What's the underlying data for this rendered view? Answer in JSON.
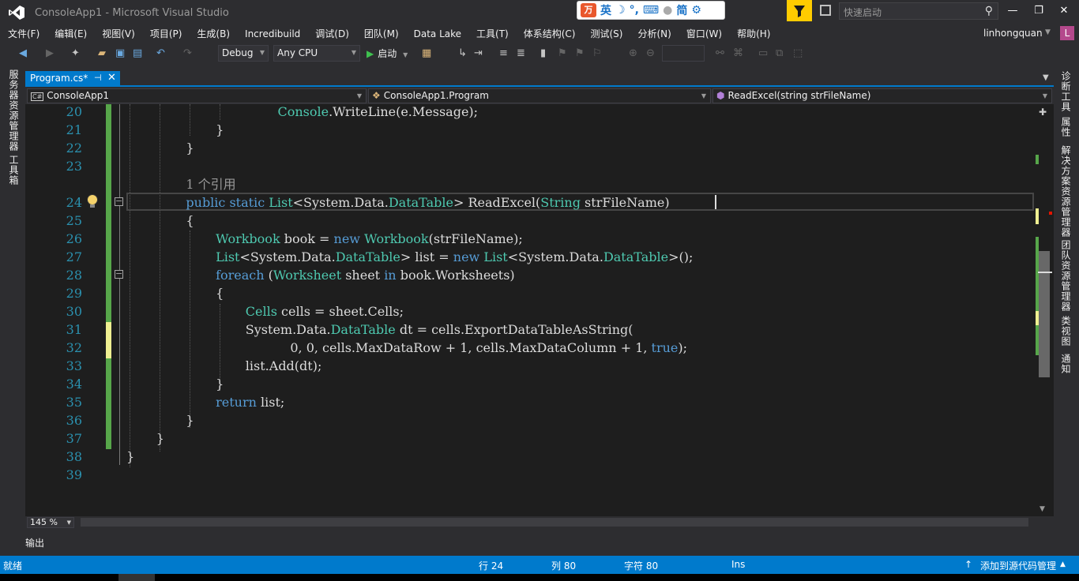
{
  "window": {
    "title": "ConsoleApp1 - Microsoft Visual Studio",
    "quick_launch_placeholder": "快速启动",
    "user": "linhongquan",
    "avatar_letter": "L"
  },
  "ime": {
    "logo": "万",
    "mode": "英",
    "script": "简"
  },
  "menu": [
    "文件(F)",
    "编辑(E)",
    "视图(V)",
    "项目(P)",
    "生成(B)",
    "Incredibuild",
    "调试(D)",
    "团队(M)",
    "Data Lake",
    "工具(T)",
    "体系结构(C)",
    "测试(S)",
    "分析(N)",
    "窗口(W)",
    "帮助(H)"
  ],
  "toolbar": {
    "configuration": "Debug",
    "platform": "Any CPU",
    "start_label": "启动"
  },
  "left_tabs": [
    "服务器资源管理器",
    "工具箱"
  ],
  "right_tabs": [
    "诊断工具",
    "属性",
    "解决方案资源管理器",
    "团队资源管理器",
    "类视图",
    "通知"
  ],
  "document_tab": "Program.cs*",
  "navbar": {
    "project": "ConsoleApp1",
    "class": "ConsoleApp1.Program",
    "member": "ReadExcel(string strFileName)"
  },
  "editor": {
    "zoom": "145 %",
    "codelens": "1 个引用",
    "lines": [
      {
        "n": "20",
        "tokens": [
          [
            "pl",
            "        "
          ],
          [
            "ty",
            "Console"
          ],
          [
            "pl",
            ".WriteLine(e.Message);"
          ]
        ],
        "indent": 4
      },
      {
        "n": "21",
        "tokens": [
          [
            "pl",
            "}"
          ]
        ],
        "indent": 3
      },
      {
        "n": "22",
        "tokens": [
          [
            "pl",
            "}"
          ]
        ],
        "indent": 2
      },
      {
        "n": "23",
        "tokens": [],
        "indent": 0
      },
      {
        "n": "",
        "tokens": [
          [
            "cl",
            "1 个引用"
          ]
        ],
        "indent": 2,
        "codelens": true
      },
      {
        "n": "24",
        "tokens": [
          [
            "kw",
            "public"
          ],
          [
            "pl",
            " "
          ],
          [
            "kw",
            "static"
          ],
          [
            "pl",
            " "
          ],
          [
            "ty",
            "List"
          ],
          [
            "pl",
            "<System.Data."
          ],
          [
            "ty",
            "DataTable"
          ],
          [
            "pl",
            "> ReadExcel("
          ],
          [
            "ty",
            "String"
          ],
          [
            "pl",
            " strFileName)"
          ]
        ],
        "indent": 2
      },
      {
        "n": "25",
        "tokens": [
          [
            "pl",
            "{"
          ]
        ],
        "indent": 2
      },
      {
        "n": "26",
        "tokens": [
          [
            "ty",
            "Workbook"
          ],
          [
            "pl",
            " book = "
          ],
          [
            "kw",
            "new"
          ],
          [
            "pl",
            " "
          ],
          [
            "ty",
            "Workbook"
          ],
          [
            "pl",
            "(strFileName);"
          ]
        ],
        "indent": 3
      },
      {
        "n": "27",
        "tokens": [
          [
            "ty",
            "List"
          ],
          [
            "pl",
            "<System.Data."
          ],
          [
            "ty",
            "DataTable"
          ],
          [
            "pl",
            "> list = "
          ],
          [
            "kw",
            "new"
          ],
          [
            "pl",
            " "
          ],
          [
            "ty",
            "List"
          ],
          [
            "pl",
            "<System.Data."
          ],
          [
            "ty",
            "DataTable"
          ],
          [
            "pl",
            ">();"
          ]
        ],
        "indent": 3
      },
      {
        "n": "28",
        "tokens": [
          [
            "kw",
            "foreach"
          ],
          [
            "pl",
            " ("
          ],
          [
            "ty",
            "Worksheet"
          ],
          [
            "pl",
            " sheet "
          ],
          [
            "kw",
            "in"
          ],
          [
            "pl",
            " book.Worksheets)"
          ]
        ],
        "indent": 3
      },
      {
        "n": "29",
        "tokens": [
          [
            "pl",
            "{"
          ]
        ],
        "indent": 3
      },
      {
        "n": "30",
        "tokens": [
          [
            "ty",
            "Cells"
          ],
          [
            "pl",
            " cells = sheet.Cells;"
          ]
        ],
        "indent": 4
      },
      {
        "n": "31",
        "tokens": [
          [
            "pl",
            "System.Data."
          ],
          [
            "ty",
            "DataTable"
          ],
          [
            "pl",
            " dt = cells.ExportDataTableAsString("
          ]
        ],
        "indent": 4
      },
      {
        "n": "32",
        "tokens": [
          [
            "pl",
            "0, 0, cells.MaxDataRow + 1, cells.MaxDataColumn + 1, "
          ],
          [
            "kw",
            "true"
          ],
          [
            "pl",
            ");"
          ]
        ],
        "indent": 5.5
      },
      {
        "n": "33",
        "tokens": [
          [
            "pl",
            "list.Add(dt);"
          ]
        ],
        "indent": 4
      },
      {
        "n": "34",
        "tokens": [
          [
            "pl",
            "}"
          ]
        ],
        "indent": 3
      },
      {
        "n": "35",
        "tokens": [
          [
            "kw",
            "return"
          ],
          [
            "pl",
            " list;"
          ]
        ],
        "indent": 3
      },
      {
        "n": "36",
        "tokens": [
          [
            "pl",
            "}"
          ]
        ],
        "indent": 2
      },
      {
        "n": "37",
        "tokens": [
          [
            "pl",
            "}"
          ]
        ],
        "indent": 1
      },
      {
        "n": "38",
        "tokens": [
          [
            "pl",
            "}"
          ]
        ],
        "indent": 0
      },
      {
        "n": "39",
        "tokens": [],
        "indent": 0
      }
    ]
  },
  "output_label": "输出",
  "status": {
    "ready": "就绪",
    "line": "行 24",
    "col": "列 80",
    "char": "字符 80",
    "mode": "Ins",
    "source_control": "添加到源代码管理"
  },
  "colors": {
    "accent": "#007acc",
    "editor_bg": "#1e1e1e",
    "keyword": "#569cd6",
    "type": "#4ec9b0"
  }
}
